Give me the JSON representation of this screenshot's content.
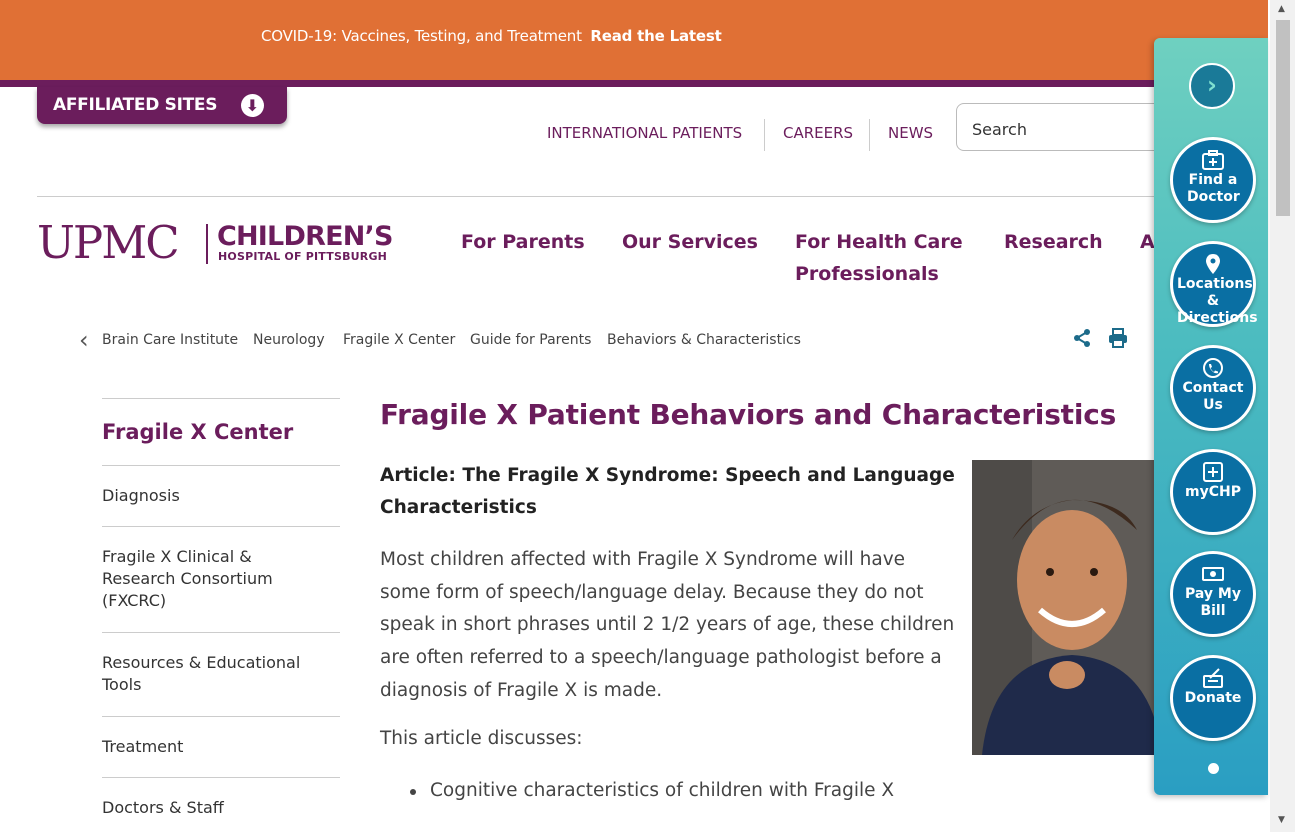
{
  "banner": {
    "text": "COVID-19: Vaccines, Testing, and Treatment",
    "link": "Read the Latest"
  },
  "affiliated": {
    "label": "AFFILIATED SITES"
  },
  "utility": {
    "links": [
      "INTERNATIONAL PATIENTS",
      "CAREERS",
      "NEWS"
    ],
    "search_placeholder": "Search"
  },
  "logo": {
    "upmc": "UPMC",
    "line1": "CHILDREN’S",
    "line2": "HOSPITAL OF PITTSBURGH"
  },
  "nav": {
    "items": [
      "For Parents",
      "Our Services",
      "For Health Care",
      "Professionals",
      "Research",
      "A"
    ]
  },
  "breadcrumb": [
    "Brain Care Institute",
    "Neurology",
    "Fragile X Center",
    "Guide for Parents",
    "Behaviors & Characteristics"
  ],
  "sidenav": {
    "title": "Fragile X Center",
    "items": [
      "Diagnosis",
      "Fragile X Clinical & Research Consortium (FXCRC)",
      "Resources & Educational Tools",
      "Treatment",
      "Doctors & Staff"
    ]
  },
  "main": {
    "title": "Fragile X Patient Behaviors and Characteristics",
    "article_heading": "Article: The Fragile X Syndrome: Speech and Language Characteristics",
    "paragraph": "Most children affected with Fragile X Syndrome will have some form of speech/language delay. Because they do not speak in short phrases until 2 1/2 years of age, these children are often referred to a speech/language pathologist before a diagnosis of Fragile X is made.",
    "paragraph2": "This article discusses:",
    "bullets": [
      "Cognitive characteristics of children with Fragile X"
    ]
  },
  "quick_panel": {
    "buttons": [
      {
        "label": "Find a Doctor",
        "icon": "medical-kit-icon"
      },
      {
        "label": "Locations & Directions",
        "icon": "map-pin-icon"
      },
      {
        "label": "Contact Us",
        "icon": "phone-icon"
      },
      {
        "label": "myCHP",
        "icon": "portal-icon"
      },
      {
        "label": "Pay My Bill",
        "icon": "money-icon"
      },
      {
        "label": "Donate",
        "icon": "donate-icon"
      }
    ]
  },
  "colors": {
    "brand_purple": "#6b1d5c",
    "banner_orange": "#e07035",
    "panel_teal": "#2a9ec2"
  }
}
